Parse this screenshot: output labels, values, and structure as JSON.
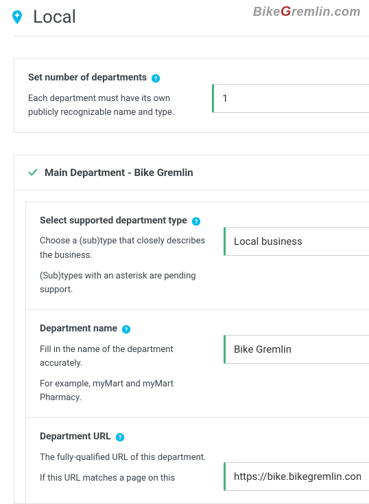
{
  "watermark": {
    "prefix": "Bike",
    "mid": "G",
    "suffix": "remlin.com"
  },
  "page": {
    "title": "Local"
  },
  "panels": {
    "departments_count": {
      "label": "Set number of departments",
      "desc": "Each department must have its own publicly recognizable name and type.",
      "value": "1"
    }
  },
  "main_department": {
    "header": "Main Department - Bike Gremlin",
    "type_row": {
      "label": "Select supported department type",
      "desc1": "Choose a (sub)type that closely describes the business.",
      "desc2": "(Sub)types with an asterisk are pending support.",
      "value": "Local business"
    },
    "name_row": {
      "label": "Department name",
      "desc1": "Fill in the name of the department accurately.",
      "desc2": "For example, myMart and myMart Pharmacy.",
      "value": "Bike Gremlin"
    },
    "url_row": {
      "label": "Department URL",
      "desc1": "The fully-qualified URL of this department.",
      "desc2": "If this URL matches a page on this",
      "value": "https://bike.bikegremlin.com/contact"
    }
  },
  "colors": {
    "accent": "#00b9eb",
    "ok": "#42b37e",
    "help": "#00b9eb"
  }
}
